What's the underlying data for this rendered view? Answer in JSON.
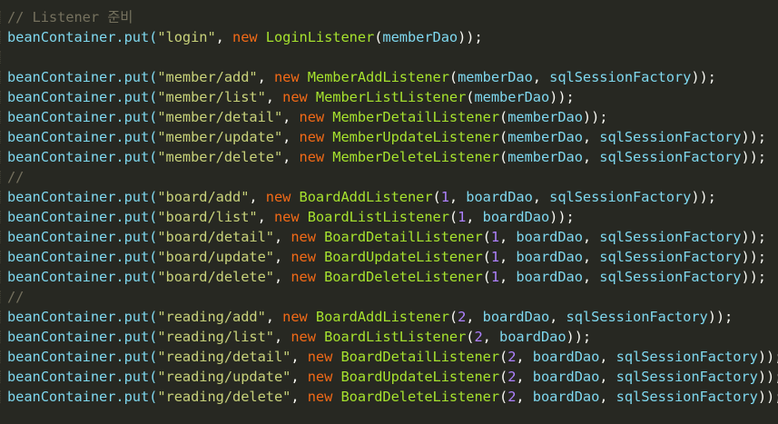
{
  "editor": {
    "lines": [
      [
        {
          "t": "com",
          "v": "// Listener 준비"
        }
      ],
      [
        {
          "t": "plain",
          "v": "beanContainer.put("
        },
        {
          "t": "str",
          "v": "\"login\""
        },
        {
          "t": "punc",
          "v": ", "
        },
        {
          "t": "kw",
          "v": "new"
        },
        {
          "t": "punc",
          "v": " "
        },
        {
          "t": "cls",
          "v": "LoginListener"
        },
        {
          "t": "punc",
          "v": "("
        },
        {
          "t": "plain",
          "v": "memberDao"
        },
        {
          "t": "punc",
          "v": "));"
        }
      ],
      [],
      [
        {
          "t": "plain",
          "v": "beanContainer.put("
        },
        {
          "t": "str",
          "v": "\"member/add\""
        },
        {
          "t": "punc",
          "v": ", "
        },
        {
          "t": "kw",
          "v": "new"
        },
        {
          "t": "punc",
          "v": " "
        },
        {
          "t": "cls",
          "v": "MemberAddListener"
        },
        {
          "t": "punc",
          "v": "("
        },
        {
          "t": "plain",
          "v": "memberDao"
        },
        {
          "t": "punc",
          "v": ", "
        },
        {
          "t": "plain",
          "v": "sqlSessionFactory"
        },
        {
          "t": "punc",
          "v": "));"
        }
      ],
      [
        {
          "t": "plain",
          "v": "beanContainer.put("
        },
        {
          "t": "str",
          "v": "\"member/list\""
        },
        {
          "t": "punc",
          "v": ", "
        },
        {
          "t": "kw",
          "v": "new"
        },
        {
          "t": "punc",
          "v": " "
        },
        {
          "t": "cls",
          "v": "MemberListListener"
        },
        {
          "t": "punc",
          "v": "("
        },
        {
          "t": "plain",
          "v": "memberDao"
        },
        {
          "t": "punc",
          "v": "));"
        }
      ],
      [
        {
          "t": "plain",
          "v": "beanContainer.put("
        },
        {
          "t": "str",
          "v": "\"member/detail\""
        },
        {
          "t": "punc",
          "v": ", "
        },
        {
          "t": "kw",
          "v": "new"
        },
        {
          "t": "punc",
          "v": " "
        },
        {
          "t": "cls",
          "v": "MemberDetailListener"
        },
        {
          "t": "punc",
          "v": "("
        },
        {
          "t": "plain",
          "v": "memberDao"
        },
        {
          "t": "punc",
          "v": "));"
        }
      ],
      [
        {
          "t": "plain",
          "v": "beanContainer.put("
        },
        {
          "t": "str",
          "v": "\"member/update\""
        },
        {
          "t": "punc",
          "v": ", "
        },
        {
          "t": "kw",
          "v": "new"
        },
        {
          "t": "punc",
          "v": " "
        },
        {
          "t": "cls",
          "v": "MemberUpdateListener"
        },
        {
          "t": "punc",
          "v": "("
        },
        {
          "t": "plain",
          "v": "memberDao"
        },
        {
          "t": "punc",
          "v": ", "
        },
        {
          "t": "plain",
          "v": "sqlSessionFactory"
        },
        {
          "t": "punc",
          "v": "));"
        }
      ],
      [
        {
          "t": "plain",
          "v": "beanContainer.put("
        },
        {
          "t": "str",
          "v": "\"member/delete\""
        },
        {
          "t": "punc",
          "v": ", "
        },
        {
          "t": "kw",
          "v": "new"
        },
        {
          "t": "punc",
          "v": " "
        },
        {
          "t": "cls",
          "v": "MemberDeleteListener"
        },
        {
          "t": "punc",
          "v": "("
        },
        {
          "t": "plain",
          "v": "memberDao"
        },
        {
          "t": "punc",
          "v": ", "
        },
        {
          "t": "plain",
          "v": "sqlSessionFactory"
        },
        {
          "t": "punc",
          "v": "));"
        }
      ],
      [
        {
          "t": "com",
          "v": "//"
        }
      ],
      [
        {
          "t": "plain",
          "v": "beanContainer.put("
        },
        {
          "t": "str",
          "v": "\"board/add\""
        },
        {
          "t": "punc",
          "v": ", "
        },
        {
          "t": "kw",
          "v": "new"
        },
        {
          "t": "punc",
          "v": " "
        },
        {
          "t": "cls",
          "v": "BoardAddListener"
        },
        {
          "t": "punc",
          "v": "("
        },
        {
          "t": "num",
          "v": "1"
        },
        {
          "t": "punc",
          "v": ", "
        },
        {
          "t": "plain",
          "v": "boardDao"
        },
        {
          "t": "punc",
          "v": ", "
        },
        {
          "t": "plain",
          "v": "sqlSessionFactory"
        },
        {
          "t": "punc",
          "v": "));"
        }
      ],
      [
        {
          "t": "plain",
          "v": "beanContainer.put("
        },
        {
          "t": "str",
          "v": "\"board/list\""
        },
        {
          "t": "punc",
          "v": ", "
        },
        {
          "t": "kw",
          "v": "new"
        },
        {
          "t": "punc",
          "v": " "
        },
        {
          "t": "cls",
          "v": "BoardListListener"
        },
        {
          "t": "punc",
          "v": "("
        },
        {
          "t": "num",
          "v": "1"
        },
        {
          "t": "punc",
          "v": ", "
        },
        {
          "t": "plain",
          "v": "boardDao"
        },
        {
          "t": "punc",
          "v": "));"
        }
      ],
      [
        {
          "t": "plain",
          "v": "beanContainer.put("
        },
        {
          "t": "str",
          "v": "\"board/detail\""
        },
        {
          "t": "punc",
          "v": ", "
        },
        {
          "t": "kw",
          "v": "new"
        },
        {
          "t": "punc",
          "v": " "
        },
        {
          "t": "cls",
          "v": "BoardDetailListener"
        },
        {
          "t": "punc",
          "v": "("
        },
        {
          "t": "num",
          "v": "1"
        },
        {
          "t": "punc",
          "v": ", "
        },
        {
          "t": "plain",
          "v": "boardDao"
        },
        {
          "t": "punc",
          "v": ", "
        },
        {
          "t": "plain",
          "v": "sqlSessionFactory"
        },
        {
          "t": "punc",
          "v": "));"
        }
      ],
      [
        {
          "t": "plain",
          "v": "beanContainer.put("
        },
        {
          "t": "str",
          "v": "\"board/update\""
        },
        {
          "t": "punc",
          "v": ", "
        },
        {
          "t": "kw",
          "v": "new"
        },
        {
          "t": "punc",
          "v": " "
        },
        {
          "t": "cls",
          "v": "BoardUpdateListener"
        },
        {
          "t": "punc",
          "v": "("
        },
        {
          "t": "num",
          "v": "1"
        },
        {
          "t": "punc",
          "v": ", "
        },
        {
          "t": "plain",
          "v": "boardDao"
        },
        {
          "t": "punc",
          "v": ", "
        },
        {
          "t": "plain",
          "v": "sqlSessionFactory"
        },
        {
          "t": "punc",
          "v": "));"
        }
      ],
      [
        {
          "t": "plain",
          "v": "beanContainer.put("
        },
        {
          "t": "str",
          "v": "\"board/delete\""
        },
        {
          "t": "punc",
          "v": ", "
        },
        {
          "t": "kw",
          "v": "new"
        },
        {
          "t": "punc",
          "v": " "
        },
        {
          "t": "cls",
          "v": "BoardDeleteListener"
        },
        {
          "t": "punc",
          "v": "("
        },
        {
          "t": "num",
          "v": "1"
        },
        {
          "t": "punc",
          "v": ", "
        },
        {
          "t": "plain",
          "v": "boardDao"
        },
        {
          "t": "punc",
          "v": ", "
        },
        {
          "t": "plain",
          "v": "sqlSessionFactory"
        },
        {
          "t": "punc",
          "v": "));"
        }
      ],
      [
        {
          "t": "com",
          "v": "//"
        }
      ],
      [
        {
          "t": "plain",
          "v": "beanContainer.put("
        },
        {
          "t": "str",
          "v": "\"reading/add\""
        },
        {
          "t": "punc",
          "v": ", "
        },
        {
          "t": "kw",
          "v": "new"
        },
        {
          "t": "punc",
          "v": " "
        },
        {
          "t": "cls",
          "v": "BoardAddListener"
        },
        {
          "t": "punc",
          "v": "("
        },
        {
          "t": "num",
          "v": "2"
        },
        {
          "t": "punc",
          "v": ", "
        },
        {
          "t": "plain",
          "v": "boardDao"
        },
        {
          "t": "punc",
          "v": ", "
        },
        {
          "t": "plain",
          "v": "sqlSessionFactory"
        },
        {
          "t": "punc",
          "v": "));"
        }
      ],
      [
        {
          "t": "plain",
          "v": "beanContainer.put("
        },
        {
          "t": "str",
          "v": "\"reading/list\""
        },
        {
          "t": "punc",
          "v": ", "
        },
        {
          "t": "kw",
          "v": "new"
        },
        {
          "t": "punc",
          "v": " "
        },
        {
          "t": "cls",
          "v": "BoardListListener"
        },
        {
          "t": "punc",
          "v": "("
        },
        {
          "t": "num",
          "v": "2"
        },
        {
          "t": "punc",
          "v": ", "
        },
        {
          "t": "plain",
          "v": "boardDao"
        },
        {
          "t": "punc",
          "v": "));"
        }
      ],
      [
        {
          "t": "plain",
          "v": "beanContainer.put("
        },
        {
          "t": "str",
          "v": "\"reading/detail\""
        },
        {
          "t": "punc",
          "v": ", "
        },
        {
          "t": "kw",
          "v": "new"
        },
        {
          "t": "punc",
          "v": " "
        },
        {
          "t": "cls",
          "v": "BoardDetailListener"
        },
        {
          "t": "punc",
          "v": "("
        },
        {
          "t": "num",
          "v": "2"
        },
        {
          "t": "punc",
          "v": ", "
        },
        {
          "t": "plain",
          "v": "boardDao"
        },
        {
          "t": "punc",
          "v": ", "
        },
        {
          "t": "plain",
          "v": "sqlSessionFactory"
        },
        {
          "t": "punc",
          "v": "));"
        }
      ],
      [
        {
          "t": "plain",
          "v": "beanContainer.put("
        },
        {
          "t": "str",
          "v": "\"reading/update\""
        },
        {
          "t": "punc",
          "v": ", "
        },
        {
          "t": "kw",
          "v": "new"
        },
        {
          "t": "punc",
          "v": " "
        },
        {
          "t": "cls",
          "v": "BoardUpdateListener"
        },
        {
          "t": "punc",
          "v": "("
        },
        {
          "t": "num",
          "v": "2"
        },
        {
          "t": "punc",
          "v": ", "
        },
        {
          "t": "plain",
          "v": "boardDao"
        },
        {
          "t": "punc",
          "v": ", "
        },
        {
          "t": "plain",
          "v": "sqlSessionFactory"
        },
        {
          "t": "punc",
          "v": "));"
        }
      ],
      [
        {
          "t": "plain",
          "v": "beanContainer.put("
        },
        {
          "t": "str",
          "v": "\"reading/delete\""
        },
        {
          "t": "punc",
          "v": ", "
        },
        {
          "t": "kw",
          "v": "new"
        },
        {
          "t": "punc",
          "v": " "
        },
        {
          "t": "cls",
          "v": "BoardDeleteListener"
        },
        {
          "t": "punc",
          "v": "("
        },
        {
          "t": "num",
          "v": "2"
        },
        {
          "t": "punc",
          "v": ", "
        },
        {
          "t": "plain",
          "v": "boardDao"
        },
        {
          "t": "punc",
          "v": ", "
        },
        {
          "t": "plain",
          "v": "sqlSessionFactory"
        },
        {
          "t": "punc",
          "v": "));"
        }
      ]
    ]
  }
}
